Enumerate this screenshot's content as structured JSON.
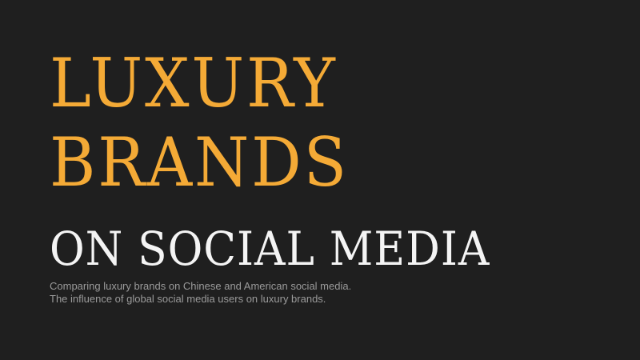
{
  "title": {
    "line1": "LUXURY",
    "line2": "BRANDS",
    "line3": "ON SOCIAL MEDIA"
  },
  "subtitle": {
    "line1": "Comparing luxury brands on Chinese and American social media.",
    "line2": "The influence of global social media users on luxury brands."
  },
  "colors": {
    "background": "#1f1f1f",
    "accent": "#f4aa36",
    "heading_white": "#f4f4f4",
    "subtitle_gray": "#9a9a9a"
  }
}
